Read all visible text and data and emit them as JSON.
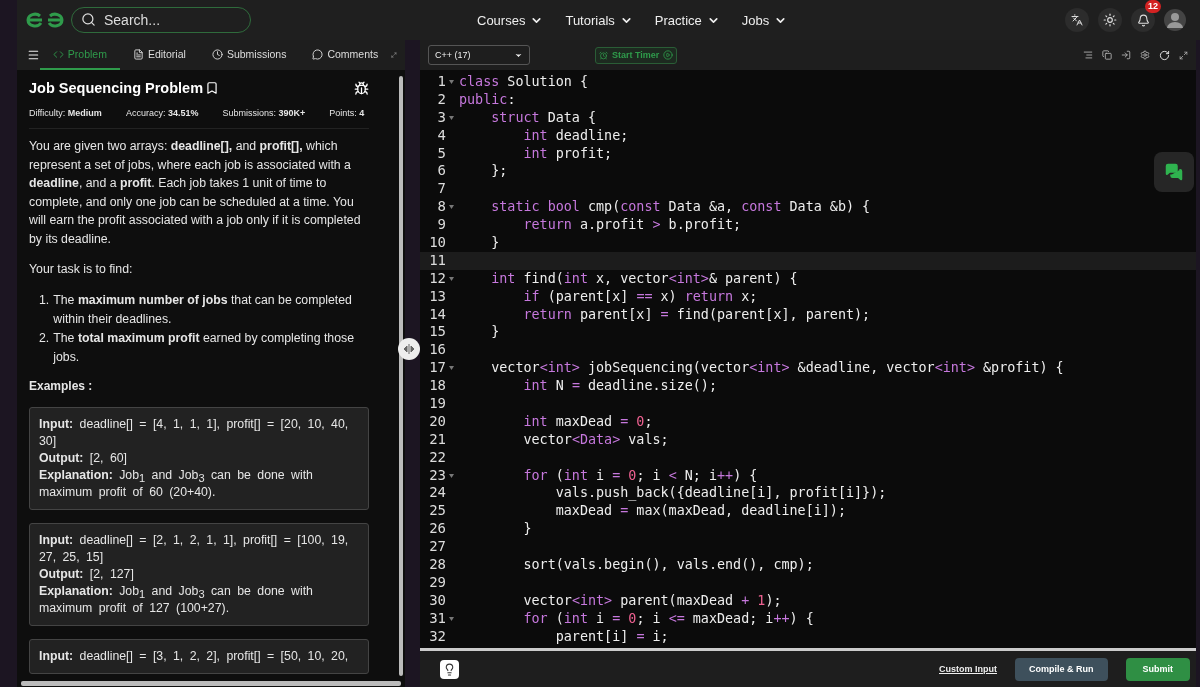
{
  "nav": {
    "search": {
      "placeholder": "Search..."
    },
    "menus": [
      "Courses",
      "Tutorials",
      "Practice",
      "Jobs"
    ],
    "notifications": "12"
  },
  "tabs": [
    {
      "label": "Problem",
      "selected": true
    },
    {
      "label": "Editorial",
      "selected": false
    },
    {
      "label": "Submissions",
      "selected": false
    },
    {
      "label": "Comments",
      "selected": false
    }
  ],
  "problem": {
    "title": "Job Sequencing Problem",
    "bookmarked": false,
    "stats": [
      {
        "label": "Difficulty:",
        "value": "Medium"
      },
      {
        "label": "Accuracy:",
        "value": "34.51%"
      },
      {
        "label": "Submissions:",
        "value": "390K+"
      },
      {
        "label": "Points:",
        "value": "4"
      }
    ],
    "intro": "You are given two arrays: **deadline[],** and **profit[],** which represent a set of jobs, where each job is associated with a **deadline**, and a **profit**. Each job takes 1 unit of time to complete, and only one job can be scheduled at a time. You will earn the profit associated with a job only if it is completed by its deadline.",
    "task": "Your task is to find:",
    "goals": [
      {
        "marker": "1.",
        "text": "The **maximum number of jobs** that can be completed within their deadlines."
      },
      {
        "marker": "2.",
        "text": "The **total maximum profit** earned by completing those jobs."
      }
    ],
    "examples_heading": "Examples :",
    "examples": [
      [
        "**Input:** deadline[] = [4, 1, 1, 1], profit[] = [20, 10, 40, 30]",
        "**Output:** [2, 60]",
        "**Explanation:** Job$_{1}$ and Job$_{3}$ can be done with maximum profit of 60 (20+40)."
      ],
      [
        "**Input:** deadline[] = [2, 1, 2, 1, 1], profit[] = [100, 19, 27, 25, 15]",
        "**Output:** [2, 127]",
        "**Explanation:** Job$_{1}$ and Job$_{3}$ can be done with maximum profit of 127 (100+27)."
      ],
      [
        "**Input:** deadline[] = [3, 1, 2, 2], profit[] = [50, 10, 20,"
      ]
    ]
  },
  "editor": {
    "language": "C++ (17)",
    "timer": "Start Timer",
    "lines": [
      {
        "n": "1",
        "fold": true,
        "current": false,
        "code": [
          {
            "kind": "keyword",
            "text": "class"
          },
          {
            "kind": "plain",
            "text": " Solution {"
          }
        ]
      },
      {
        "n": "2",
        "fold": false,
        "current": false,
        "code": [
          {
            "kind": "keyword",
            "text": "public"
          },
          {
            "kind": "plain",
            "text": ":"
          }
        ]
      },
      {
        "n": "3",
        "fold": true,
        "current": false,
        "code": [
          {
            "kind": "keyword",
            "text": "    struct"
          },
          {
            "kind": "plain",
            "text": " Data {"
          }
        ]
      },
      {
        "n": "4",
        "fold": false,
        "current": false,
        "code": [
          {
            "kind": "keyword",
            "text": "        int"
          },
          {
            "kind": "plain",
            "text": " deadline;"
          }
        ]
      },
      {
        "n": "5",
        "fold": false,
        "current": false,
        "code": [
          {
            "kind": "keyword",
            "text": "        int"
          },
          {
            "kind": "plain",
            "text": " profit;"
          }
        ]
      },
      {
        "n": "6",
        "fold": false,
        "current": false,
        "code": [
          {
            "kind": "plain",
            "text": "    };"
          }
        ]
      },
      {
        "n": "7",
        "fold": false,
        "current": false
      },
      {
        "n": "8",
        "fold": true,
        "current": false,
        "code": [
          {
            "kind": "keyword",
            "text": "    static bool"
          },
          {
            "kind": "plain",
            "text": " cmp("
          },
          {
            "kind": "keyword",
            "text": "const"
          },
          {
            "kind": "plain",
            "text": " Data &a, "
          },
          {
            "kind": "keyword",
            "text": "const"
          },
          {
            "kind": "plain",
            "text": " Data &b) {"
          }
        ]
      },
      {
        "n": "9",
        "fold": false,
        "current": false,
        "code": [
          {
            "kind": "keyword",
            "text": "        return"
          },
          {
            "kind": "plain",
            "text": " a.profit "
          },
          {
            "kind": "keyword",
            "text": ">"
          },
          {
            "kind": "plain",
            "text": " b.profit;"
          }
        ]
      },
      {
        "n": "10",
        "fold": false,
        "current": false,
        "code": [
          {
            "kind": "plain",
            "text": "    }"
          }
        ]
      },
      {
        "n": "11",
        "fold": false,
        "current": true
      },
      {
        "n": "12",
        "fold": true,
        "current": false,
        "code": [
          {
            "kind": "keyword",
            "text": "    int"
          },
          {
            "kind": "plain",
            "text": " find("
          },
          {
            "kind": "keyword",
            "text": "int"
          },
          {
            "kind": "plain",
            "text": " x, vector"
          },
          {
            "kind": "keyword",
            "text": "<int>"
          },
          {
            "kind": "plain",
            "text": "& parent) {"
          }
        ]
      },
      {
        "n": "13",
        "fold": false,
        "current": false,
        "code": [
          {
            "kind": "keyword",
            "text": "        if"
          },
          {
            "kind": "plain",
            "text": " (parent[x] "
          },
          {
            "kind": "keyword",
            "text": "=="
          },
          {
            "kind": "plain",
            "text": " x) "
          },
          {
            "kind": "keyword",
            "text": "return"
          },
          {
            "kind": "plain",
            "text": " x;"
          }
        ]
      },
      {
        "n": "14",
        "fold": false,
        "current": false,
        "code": [
          {
            "kind": "keyword",
            "text": "        return"
          },
          {
            "kind": "plain",
            "text": " parent[x] "
          },
          {
            "kind": "keyword",
            "text": "="
          },
          {
            "kind": "plain",
            "text": " find(parent[x], parent);"
          }
        ]
      },
      {
        "n": "15",
        "fold": false,
        "current": false,
        "code": [
          {
            "kind": "plain",
            "text": "    }"
          }
        ]
      },
      {
        "n": "16",
        "fold": false,
        "current": false
      },
      {
        "n": "17",
        "fold": true,
        "current": false,
        "code": [
          {
            "kind": "plain",
            "text": "    vector"
          },
          {
            "kind": "keyword",
            "text": "<int>"
          },
          {
            "kind": "plain",
            "text": " jobSequencing(vector"
          },
          {
            "kind": "keyword",
            "text": "<int>"
          },
          {
            "kind": "plain",
            "text": " &deadline, vector"
          },
          {
            "kind": "keyword",
            "text": "<int>"
          },
          {
            "kind": "plain",
            "text": " &profit) {"
          }
        ]
      },
      {
        "n": "18",
        "fold": false,
        "current": false,
        "code": [
          {
            "kind": "keyword",
            "text": "        int"
          },
          {
            "kind": "plain",
            "text": " N "
          },
          {
            "kind": "keyword",
            "text": "="
          },
          {
            "kind": "plain",
            "text": " deadline.size();"
          }
        ]
      },
      {
        "n": "19",
        "fold": false,
        "current": false
      },
      {
        "n": "20",
        "fold": false,
        "current": false,
        "code": [
          {
            "kind": "keyword",
            "text": "        int"
          },
          {
            "kind": "plain",
            "text": " maxDead "
          },
          {
            "kind": "keyword",
            "text": "="
          },
          {
            "kind": "number",
            "text": " 0"
          },
          {
            "kind": "plain",
            "text": ";"
          }
        ]
      },
      {
        "n": "21",
        "fold": false,
        "current": false,
        "code": [
          {
            "kind": "plain",
            "text": "        vector"
          },
          {
            "kind": "keyword",
            "text": "<Data>"
          },
          {
            "kind": "plain",
            "text": " vals;"
          }
        ]
      },
      {
        "n": "22",
        "fold": false,
        "current": false
      },
      {
        "n": "23",
        "fold": true,
        "current": false,
        "code": [
          {
            "kind": "keyword",
            "text": "        for"
          },
          {
            "kind": "plain",
            "text": " ("
          },
          {
            "kind": "keyword",
            "text": "int"
          },
          {
            "kind": "plain",
            "text": " i "
          },
          {
            "kind": "keyword",
            "text": "="
          },
          {
            "kind": "number",
            "text": " 0"
          },
          {
            "kind": "plain",
            "text": "; i "
          },
          {
            "kind": "keyword",
            "text": "<"
          },
          {
            "kind": "plain",
            "text": " N; i"
          },
          {
            "kind": "keyword",
            "text": "++"
          },
          {
            "kind": "plain",
            "text": ") {"
          }
        ]
      },
      {
        "n": "24",
        "fold": false,
        "current": false,
        "code": [
          {
            "kind": "plain",
            "text": "            vals.push_back({deadline[i], profit[i]});"
          }
        ]
      },
      {
        "n": "25",
        "fold": false,
        "current": false,
        "code": [
          {
            "kind": "plain",
            "text": "            maxDead "
          },
          {
            "kind": "keyword",
            "text": "="
          },
          {
            "kind": "plain",
            "text": " max(maxDead, deadline[i]);"
          }
        ]
      },
      {
        "n": "26",
        "fold": false,
        "current": false,
        "code": [
          {
            "kind": "plain",
            "text": "        }"
          }
        ]
      },
      {
        "n": "27",
        "fold": false,
        "current": false
      },
      {
        "n": "28",
        "fold": false,
        "current": false,
        "code": [
          {
            "kind": "plain",
            "text": "        sort(vals.begin(), vals.end(), cmp);"
          }
        ]
      },
      {
        "n": "29",
        "fold": false,
        "current": false
      },
      {
        "n": "30",
        "fold": false,
        "current": false,
        "code": [
          {
            "kind": "plain",
            "text": "        vector"
          },
          {
            "kind": "keyword",
            "text": "<int>"
          },
          {
            "kind": "plain",
            "text": " parent(maxDead "
          },
          {
            "kind": "keyword",
            "text": "+"
          },
          {
            "kind": "number",
            "text": " 1"
          },
          {
            "kind": "plain",
            "text": ");"
          }
        ]
      },
      {
        "n": "31",
        "fold": true,
        "current": false,
        "code": [
          {
            "kind": "keyword",
            "text": "        for"
          },
          {
            "kind": "plain",
            "text": " ("
          },
          {
            "kind": "keyword",
            "text": "int"
          },
          {
            "kind": "plain",
            "text": " i "
          },
          {
            "kind": "keyword",
            "text": "="
          },
          {
            "kind": "number",
            "text": " 0"
          },
          {
            "kind": "plain",
            "text": "; i "
          },
          {
            "kind": "keyword",
            "text": "<="
          },
          {
            "kind": "plain",
            "text": " maxDead; i"
          },
          {
            "kind": "keyword",
            "text": "++"
          },
          {
            "kind": "plain",
            "text": ") {"
          }
        ]
      },
      {
        "n": "32",
        "fold": false,
        "current": false,
        "code": [
          {
            "kind": "plain",
            "text": "            parent[i] "
          },
          {
            "kind": "keyword",
            "text": "="
          },
          {
            "kind": "plain",
            "text": " i;"
          }
        ]
      }
    ],
    "actions": [
      {
        "label": "Custom Input",
        "kind": "link"
      },
      {
        "label": "Compile & Run",
        "kind": "secondary"
      },
      {
        "label": "Submit",
        "kind": "primary"
      }
    ]
  }
}
